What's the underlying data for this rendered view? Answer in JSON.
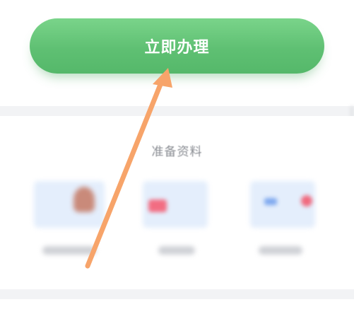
{
  "apply": {
    "label": "立即办理"
  },
  "materials": {
    "title": "准备资料",
    "items": [
      {
        "icon": "person-document-icon"
      },
      {
        "icon": "card-document-icon"
      },
      {
        "icon": "map-document-icon"
      }
    ]
  },
  "colors": {
    "button_green": "#5fc073",
    "arrow_orange": "#f7a46a",
    "section_title_gray": "#8a8d93",
    "divider_gray": "#f2f3f5"
  }
}
